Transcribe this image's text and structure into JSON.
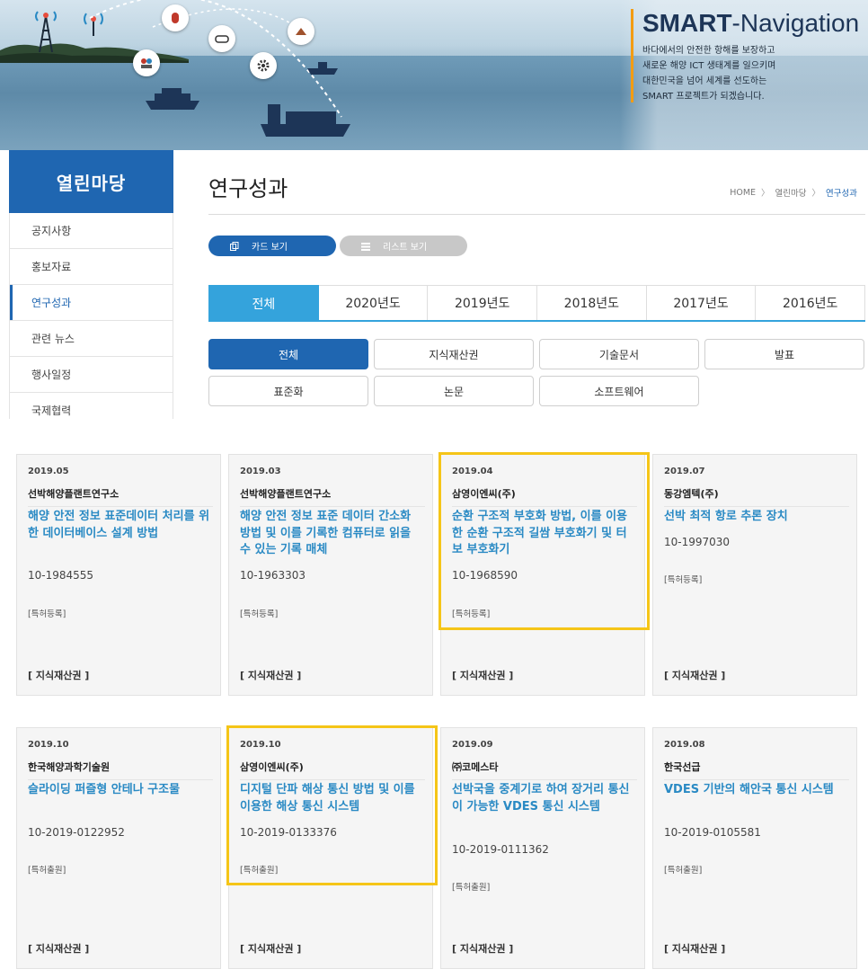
{
  "banner": {
    "brand_bold": "SMART",
    "brand_rest": "-Navigation",
    "desc": [
      "바다에서의 안전한 항해를 보장하고",
      "새로운 해양 ICT 생태계를 일으키며",
      "대한민국을 넘어 세계를 선도하는",
      "SMART 프로젝트가 되겠습니다."
    ]
  },
  "sidebar": {
    "title": "열린마당",
    "items": [
      {
        "label": "공지사항"
      },
      {
        "label": "홍보자료"
      },
      {
        "label": "연구성과"
      },
      {
        "label": "관련 뉴스"
      },
      {
        "label": "행사일정"
      },
      {
        "label": "국제협력"
      }
    ],
    "active_index": 2
  },
  "page": {
    "title": "연구성과",
    "breadcrumb": [
      "HOME",
      "열린마당",
      "연구성과"
    ]
  },
  "view_toggle": {
    "card_label": "카드 보기",
    "list_label": "리스트 보기",
    "active": "card"
  },
  "year_tabs": [
    "전체",
    "2020년도",
    "2019년도",
    "2018년도",
    "2017년도",
    "2016년도"
  ],
  "categories": [
    "전체",
    "지식재산권",
    "기술문서",
    "발표",
    "표준화",
    "논문",
    "소프트웨어"
  ],
  "cards": [
    {
      "date": "2019.05",
      "org": "선박해양플랜트연구소",
      "title": "해양 안전 정보 표준데이터 처리를 위한 데이터베이스 설계 방법",
      "number": "10-1984555",
      "tag": "[특허등록]",
      "category": "[ 지식재산권 ]"
    },
    {
      "date": "2019.03",
      "org": "선박해양플랜트연구소",
      "title": "해양 안전 정보 표준 데이터 간소화 방법 및 이를 기록한 컴퓨터로 읽을 수 있는 기록 매체",
      "number": "10-1963303",
      "tag": "[특허등록]",
      "category": "[ 지식재산권 ]"
    },
    {
      "date": "2019.04",
      "org": "삼영이엔씨(주)",
      "title": "순환 구조적 부호화 방법, 이를 이용한 순환 구조적 길쌈 부호화기 및 터보 부호화기",
      "number": "10-1968590",
      "tag": "[특허등록]",
      "category": "[ 지식재산권 ]"
    },
    {
      "date": "2019.07",
      "org": "동강엠텍(주)",
      "title": "선박 최적 항로 추론 장치",
      "number": "10-1997030",
      "tag": "[특허등록]",
      "category": "[ 지식재산권 ]"
    },
    {
      "date": "2019.10",
      "org": "한국해양과학기술원",
      "title": "슬라이딩 퍼즐형 안테나 구조물",
      "number": "10-2019-0122952",
      "tag": "[특허출원]",
      "category": "[ 지식재산권 ]"
    },
    {
      "date": "2019.10",
      "org": "삼영이엔씨(주)",
      "title": "디지털 단파 해상 통신 방법 및 이를 이용한 해상 통신 시스템",
      "number": "10-2019-0133376",
      "tag": "[특허출원]",
      "category": "[ 지식재산권 ]"
    },
    {
      "date": "2019.09",
      "org": "㈜코메스타",
      "title": "선박국을 중계기로 하여 장거리 통신이 가능한 VDES 통신 시스템",
      "number": "10-2019-0111362",
      "tag": "[특허출원]",
      "category": "[ 지식재산권 ]"
    },
    {
      "date": "2019.08",
      "org": "한국선급",
      "title": "VDES 기반의 해안국 통신 시스템",
      "number": "10-2019-0105581",
      "tag": "[특허출원]",
      "category": "[ 지식재산권 ]"
    }
  ],
  "colors": {
    "primary": "#1f66b1",
    "tab_active": "#34a3dc",
    "card_title": "#2a8ac4",
    "highlight": "#f5c518",
    "brand_bar": "#f39c12"
  }
}
